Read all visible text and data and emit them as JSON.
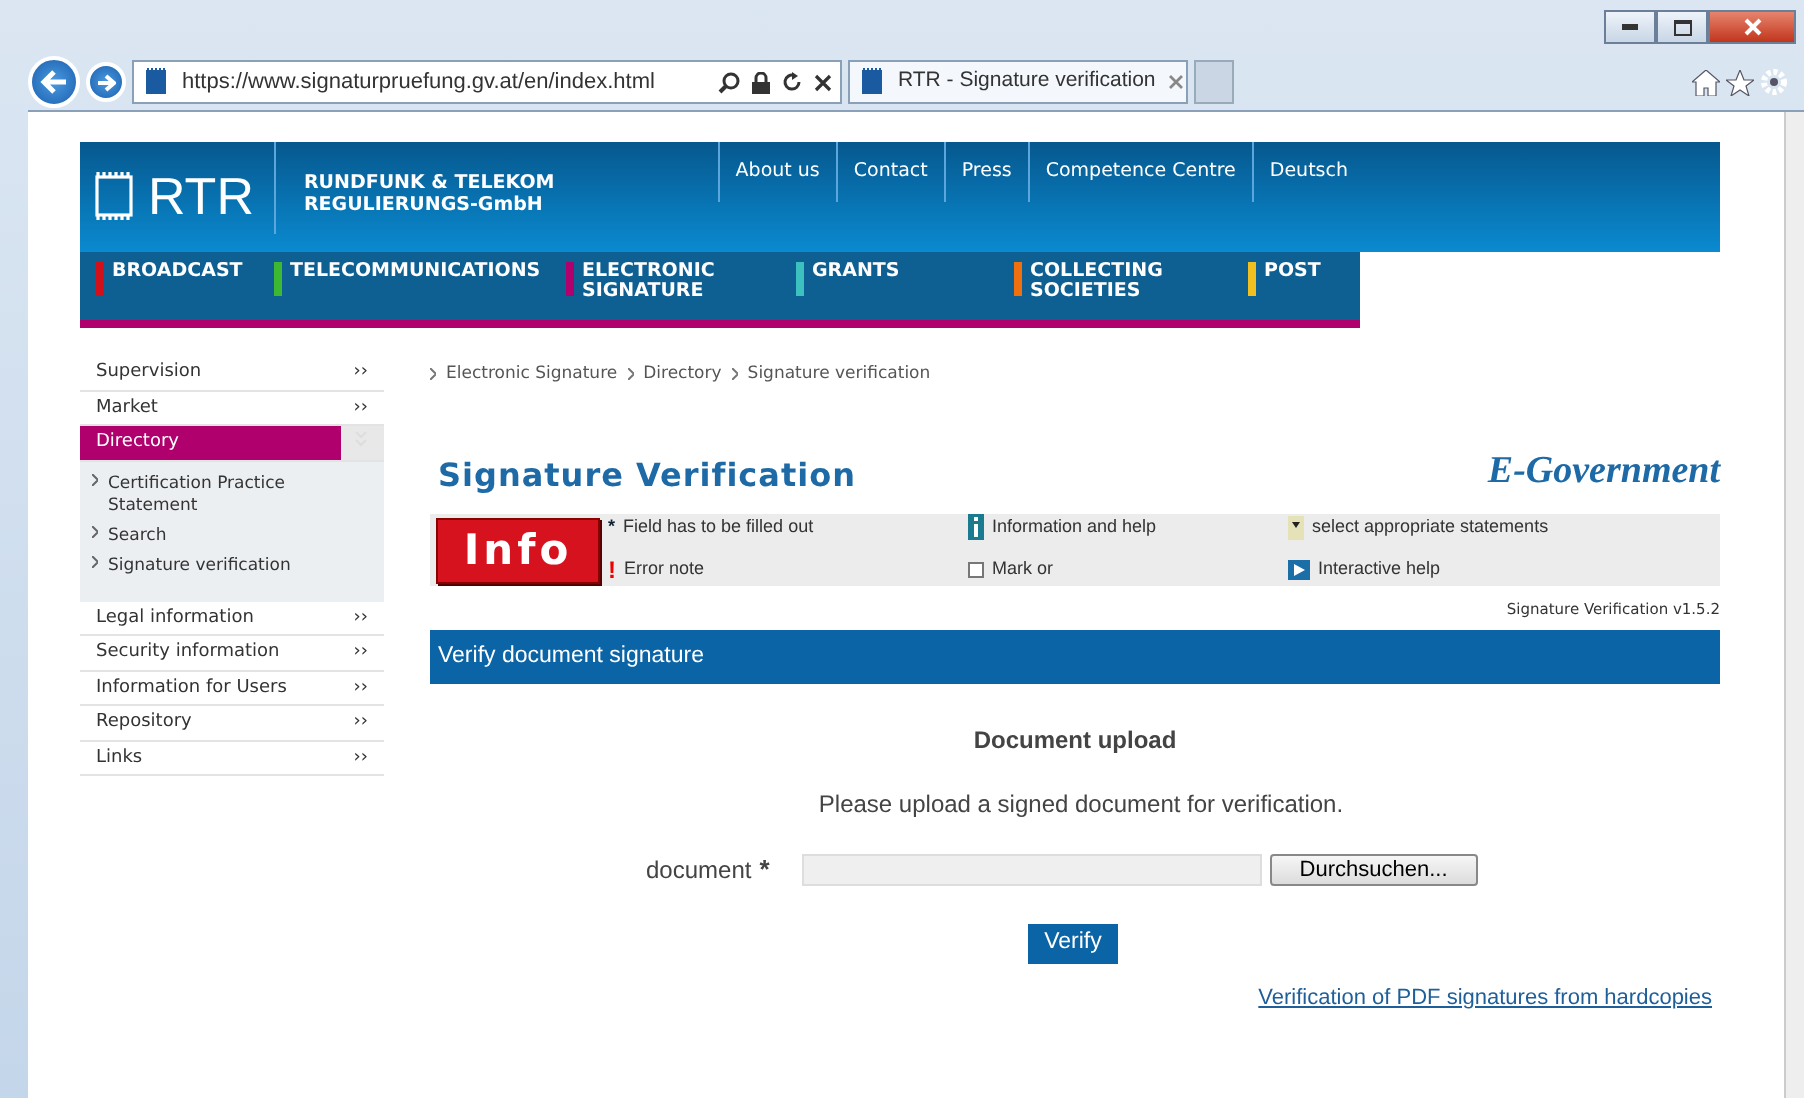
{
  "browser": {
    "address": "https://www.signaturpruefung.gv.at/en/index.html",
    "tab": "RTR - Signature verification"
  },
  "header": {
    "logo": "RTR",
    "org_line_1": "RUNDFUNK & TELEKOM",
    "org_line_2": "REGULIERUNGS-GmbH",
    "top_links": [
      "About us",
      "Contact",
      "Press",
      "Competence Centre",
      "Deutsch"
    ],
    "nav": [
      {
        "label": "BROADCAST",
        "color": "#d0101a",
        "selected": false
      },
      {
        "label": "TELECOMMUNICATIONS",
        "color": "#3cb832",
        "selected": false
      },
      {
        "label": "ELECTRONIC SIGNATURE",
        "color": "#b0006e",
        "selected": true
      },
      {
        "label": "GRANTS",
        "color": "#3cc0c0",
        "selected": false
      },
      {
        "label": "COLLECTING SOCIETIES",
        "color": "#f07010",
        "selected": false
      },
      {
        "label": "POST",
        "color": "#f0c020",
        "selected": false
      }
    ]
  },
  "sidebar": [
    {
      "label": "Supervision",
      "marker": "››",
      "expanded": false
    },
    {
      "label": "Market",
      "marker": "››",
      "expanded": false
    },
    {
      "label": "Directory",
      "expanded": true,
      "children": [
        {
          "label": "Certification Practice Statement"
        },
        {
          "label": "Search"
        },
        {
          "label": "Signature verification"
        }
      ]
    },
    {
      "label": "Legal information",
      "marker": "››",
      "expanded": false
    },
    {
      "label": "Security information",
      "marker": "››",
      "expanded": false
    },
    {
      "label": "Information for Users",
      "marker": "››",
      "expanded": false
    },
    {
      "label": "Repository",
      "marker": "››",
      "expanded": false
    },
    {
      "label": "Links",
      "marker": "››",
      "expanded": false
    }
  ],
  "breadcrumb": [
    "Electronic Signature",
    "Directory",
    "Signature verification"
  ],
  "title": "Signature Verification",
  "brand": "E-Government",
  "legend": {
    "badge": "Info",
    "items": [
      {
        "kind": "asterisk",
        "symbol": "*",
        "label": "Field has to be filled out"
      },
      {
        "kind": "info",
        "label": "Information and help"
      },
      {
        "kind": "select",
        "label": "select appropriate statements"
      },
      {
        "kind": "error",
        "symbol": "!",
        "label": "Error note"
      },
      {
        "kind": "check",
        "label": "Mark or"
      },
      {
        "kind": "play",
        "label": "Interactive help"
      }
    ]
  },
  "version": "Signature Verification v1.5.2",
  "section": "Verify document signature",
  "upload": {
    "heading": "Document upload",
    "text": "Please upload a signed document for verification.",
    "label": "document",
    "required": "*",
    "browse": "Durchsuchen...",
    "submit": "Verify",
    "link": "Verification of PDF signatures from hardcopies"
  }
}
